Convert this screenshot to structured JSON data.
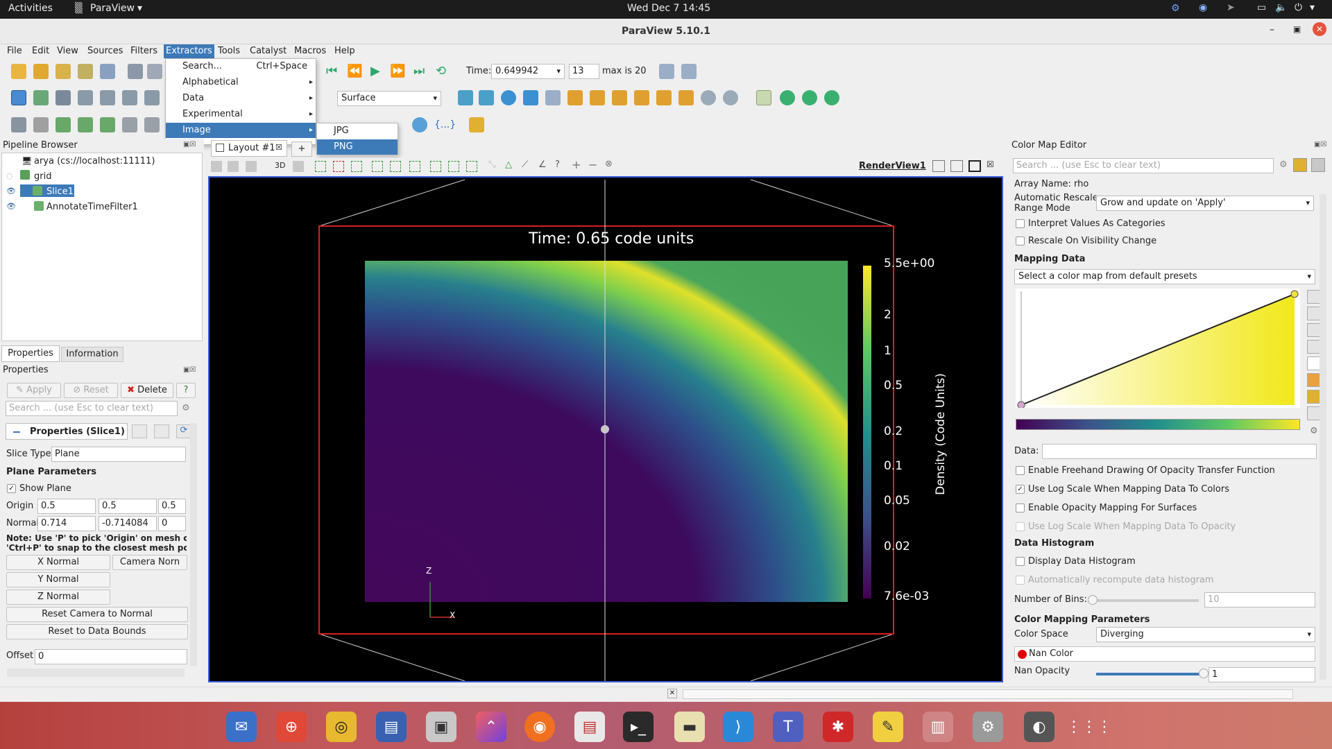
{
  "topbar": {
    "activities": "Activities",
    "app": "ParaView",
    "app_arrow": "▾",
    "clock": "Wed Dec 7  14:45"
  },
  "window": {
    "title": "ParaView 5.10.1"
  },
  "menus": [
    "File",
    "Edit",
    "View",
    "Sources",
    "Filters",
    "Extractors",
    "Tools",
    "Catalyst",
    "Macros",
    "Help"
  ],
  "extractors_menu": {
    "items": [
      {
        "label": "Search...",
        "shortcut": "Ctrl+Space"
      },
      {
        "label": "Alphabetical"
      },
      {
        "label": "Data"
      },
      {
        "label": "Experimental"
      },
      {
        "label": "Image"
      }
    ],
    "image_submenu": [
      "JPG",
      "PNG"
    ]
  },
  "toolbar": {
    "time_label": "Time:",
    "time_value": "0.649942",
    "timestep": "13",
    "max_label": "max is 20",
    "representation": "Surface"
  },
  "pipeline": {
    "title": "Pipeline Browser",
    "items": [
      "arya (cs://localhost:11111)",
      "grid",
      "Slice1",
      "AnnotateTimeFilter1"
    ]
  },
  "properties": {
    "tabs": [
      "Properties",
      "Information"
    ],
    "title": "Properties",
    "apply": "Apply",
    "reset": "Reset",
    "delete": "Delete",
    "help": "?",
    "search_placeholder": "Search ... (use Esc to clear text)",
    "section": "Properties (Slice1)",
    "slice_type_label": "Slice Type",
    "slice_type": "Plane",
    "plane_params": "Plane Parameters",
    "show_plane": "Show Plane",
    "origin_label": "Origin",
    "origin": [
      "0.5",
      "0.5",
      "0.5"
    ],
    "normal_label": "Normal",
    "normal": [
      "0.714",
      "-0.714084",
      "0"
    ],
    "note": "Note: Use 'P' to pick 'Origin' on mesh c",
    "note2": "'Ctrl+P' to snap to the closest mesh pc",
    "x_normal": "X Normal",
    "camera_normal": "Camera Norn",
    "y_normal": "Y Normal",
    "z_normal": "Z Normal",
    "reset_camera": "Reset Camera to Normal",
    "reset_bounds": "Reset to Data Bounds",
    "offset_label": "Offset",
    "offset": "0"
  },
  "layout": {
    "tab": "Layout #1",
    "add": "+",
    "view_name": "RenderView1",
    "three_d": "3D"
  },
  "render": {
    "annotation": "Time: 0.65 code units",
    "axis_z": "Z",
    "axis_x": "X",
    "colorbar": {
      "title": "Density (Code Units)",
      "ticks": [
        "5.5e+00",
        "2",
        "1",
        "0.5",
        "0.2",
        "0.1",
        "0.05",
        "0.02",
        "7.6e-03"
      ]
    }
  },
  "colormap": {
    "title": "Color Map Editor",
    "search_placeholder": "Search ... (use Esc to clear text)",
    "array_name": "Array Name: rho",
    "auto_rescale_label1": "Automatic Rescale",
    "auto_rescale_label2": "Range Mode",
    "auto_rescale": "Grow and update on 'Apply'",
    "interpret": "Interpret Values As Categories",
    "rescale_vis": "Rescale On Visibility Change",
    "mapping_data": "Mapping Data",
    "preset": "Select a color map from default presets",
    "data_label": "Data:",
    "freehand": "Enable Freehand Drawing Of Opacity Transfer Function",
    "log_scale": "Use Log Scale When Mapping Data To Colors",
    "opacity_surfaces": "Enable Opacity Mapping For Surfaces",
    "log_opacity": "Use Log Scale When Mapping Data To Opacity",
    "histogram": "Data Histogram",
    "display_hist": "Display Data Histogram",
    "auto_recompute": "Automatically recompute data histogram",
    "bins_label": "Number of Bins:",
    "bins": "10",
    "params": "Color Mapping Parameters",
    "color_space_label": "Color Space",
    "color_space": "Diverging",
    "nan_color": "Nan Color",
    "nan_opacity_label": "Nan Opacity",
    "nan_opacity": "1"
  },
  "colors": {
    "accent": "#3d7ab8",
    "frame": "#d62020",
    "nan": "#e00000"
  }
}
